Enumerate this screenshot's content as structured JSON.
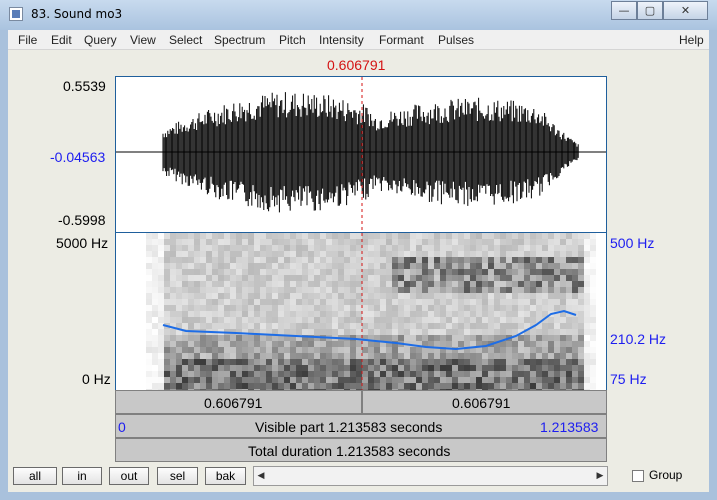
{
  "window": {
    "title": "83. Sound mo3",
    "minimize": "—",
    "maximize": "▢",
    "close": "✕"
  },
  "menu": [
    "File",
    "Edit",
    "Query",
    "View",
    "Select",
    "Spectrum",
    "Pitch",
    "Intensity",
    "Formant",
    "Pulses",
    "Help"
  ],
  "cursor": {
    "time": "0.606791"
  },
  "waveform": {
    "max_label": "0.5539",
    "mid_label": "-0.04563",
    "min_label": "-0.5998"
  },
  "spectrogram": {
    "top_label": "5000 Hz",
    "bottom_label": "0 Hz",
    "pitch_top_label": "500 Hz",
    "pitch_mid_label": "210.2 Hz",
    "pitch_bottom_label": "75 Hz",
    "pitch_color": "#1e6de6"
  },
  "timebar": {
    "left_time": "0.606791",
    "right_time": "0.606791",
    "visible_start": "0",
    "visible_label": "Visible part 1.213583 seconds",
    "visible_end": "1.213583",
    "total_label": "Total duration 1.213583 seconds"
  },
  "buttons": {
    "all": "all",
    "in": "in",
    "out": "out",
    "sel": "sel",
    "bak": "bak"
  },
  "scroll": {
    "left_arrow": "◀",
    "right_arrow": "▶"
  },
  "group": {
    "label": "Group",
    "checked": false
  },
  "colors": {
    "cursor": "#d41313",
    "axis_blue": "#1d1df0",
    "frame": "#1f5f9c"
  }
}
